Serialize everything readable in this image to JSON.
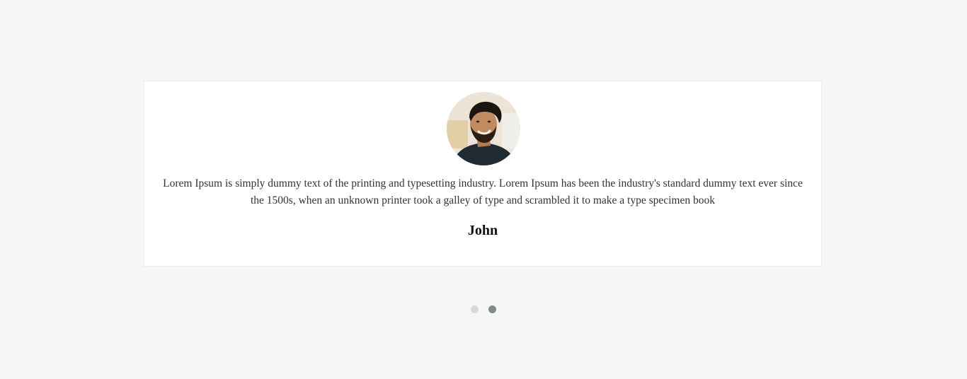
{
  "testimonial": {
    "quote": "Lorem Ipsum is simply dummy text of the printing and typesetting industry. Lorem Ipsum has been the industry's standard dummy text ever since the 1500s, when an unknown printer took a galley of type and scrambled it to make a type specimen book",
    "name": "John",
    "avatar_icon": "person-photo"
  },
  "pagination": {
    "count": 2,
    "active_index": 1
  },
  "colors": {
    "page_background": "#f6f6f6",
    "card_background": "#ffffff",
    "dot_inactive": "#d8d8d8",
    "dot_active": "#7f8c8a"
  }
}
